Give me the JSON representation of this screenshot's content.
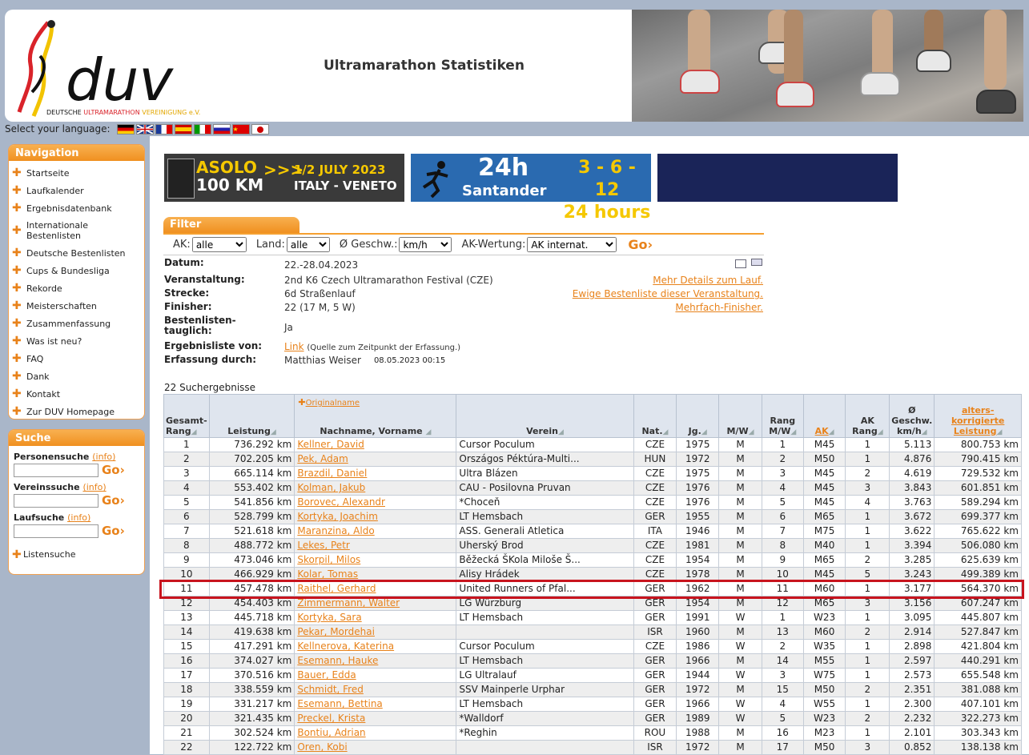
{
  "header": {
    "title": "Ultramarathon Statistiken",
    "logo_text": "duv",
    "logo_sub": [
      "DEUTSCHE",
      "ULTRAMARATHON",
      "VEREINIGUNG e.V."
    ]
  },
  "language": {
    "label": "Select your language:"
  },
  "navigation": {
    "title": "Navigation",
    "items": [
      "Startseite",
      "Laufkalender",
      "Ergebnisdatenbank",
      "Internationale Bestenlisten",
      "Deutsche Bestenlisten",
      "Cups & Bundesliga",
      "Rekorde",
      "Meisterschaften",
      "Zusammenfassung",
      "Was ist neu?",
      "FAQ",
      "Dank",
      "Kontakt",
      "Zur DUV Homepage"
    ]
  },
  "search": {
    "title": "Suche",
    "person": "Personensuche",
    "verein": "Vereinssuche",
    "lauf": "Laufsuche",
    "info": "(info)",
    "go": "Go",
    "list": "Listensuche"
  },
  "banners": {
    "asolo_a": "ASOLO",
    "asolo_b": "100 KM",
    "asolo_c": "1/2 JULY 2023",
    "asolo_d": "ITALY - VENETO",
    "santander_a": "24h",
    "santander_b": "Santander",
    "santander_c": "3 - 6 - 12",
    "santander_d": "24 hours"
  },
  "filter": {
    "title": "Filter",
    "ak_label": "AK:",
    "ak_value": "alle",
    "land_label": "Land:",
    "land_value": "alle",
    "speed_label": "Ø Geschw.:",
    "speed_value": "km/h",
    "akw_label": "AK-Wertung:",
    "akw_value": "AK internat.",
    "go": "Go"
  },
  "event": {
    "datum_label": "Datum:",
    "datum": "22.-28.04.2023",
    "veranst_label": "Veranstaltung:",
    "veranst": "2nd K6 Czech Ultramarathon Festival (CZE)",
    "strecke_label": "Strecke:",
    "strecke": "6d Straßenlauf",
    "finisher_label": "Finisher:",
    "finisher": "22 (17 M, 5 W)",
    "best_label": "Bestenlisten-tauglich:",
    "best": "Ja",
    "ergebnis_label": "Ergebnisliste von:",
    "ergebnis_link": "Link",
    "ergebnis_note": "(Quelle zum Zeitpunkt der Erfassung.)",
    "erfassung_label": "Erfassung durch:",
    "erfassung": "Matthias Weiser",
    "erfassung_time": "08.05.2023 00:15",
    "link_details": "Mehr Details zum Lauf.",
    "link_ewige": "Ewige Bestenliste dieser Veranstaltung.",
    "link_mehrfach": "Mehrfach-Finisher."
  },
  "results": {
    "count": "22 Suchergebnisse",
    "originalname": "Originalname",
    "headers": {
      "rang": "Gesamt-Rang",
      "leistung": "Leistung",
      "name": "Nachname, Vorname",
      "verein": "Verein",
      "nat": "Nat.",
      "jg": "Jg.",
      "mw": "M/W",
      "rangmw": "Rang M/W",
      "ak": "AK",
      "akrang": "AK Rang",
      "speed": "Ø Geschw. km/h",
      "alters": "alters-korrigierte Leistung"
    },
    "rows": [
      [
        "1",
        "736.292 km",
        "Kellner, David",
        "Cursor Poculum",
        "CZE",
        "1975",
        "M",
        "1",
        "M45",
        "1",
        "5.113",
        "800.753 km"
      ],
      [
        "2",
        "702.205 km",
        "Pek, Adam",
        "Országos Péktúra-Multi...",
        "HUN",
        "1972",
        "M",
        "2",
        "M50",
        "1",
        "4.876",
        "790.415 km"
      ],
      [
        "3",
        "665.114 km",
        "Brazdil, Daniel",
        "Ultra Blázen",
        "CZE",
        "1975",
        "M",
        "3",
        "M45",
        "2",
        "4.619",
        "729.532 km"
      ],
      [
        "4",
        "553.402 km",
        "Kolman, Jakub",
        "CAU - Posilovna Pruvan",
        "CZE",
        "1976",
        "M",
        "4",
        "M45",
        "3",
        "3.843",
        "601.851 km"
      ],
      [
        "5",
        "541.856 km",
        "Borovec, Alexandr",
        "*Choceň",
        "CZE",
        "1976",
        "M",
        "5",
        "M45",
        "4",
        "3.763",
        "589.294 km"
      ],
      [
        "6",
        "528.799 km",
        "Kortyka, Joachim",
        "LT Hemsbach",
        "GER",
        "1955",
        "M",
        "6",
        "M65",
        "1",
        "3.672",
        "699.377 km"
      ],
      [
        "7",
        "521.618 km",
        "Maranzina, Aldo",
        "ASS. Generali Atletica",
        "ITA",
        "1946",
        "M",
        "7",
        "M75",
        "1",
        "3.622",
        "765.622 km"
      ],
      [
        "8",
        "488.772 km",
        "Lekes, Petr",
        "Uherský Brod",
        "CZE",
        "1981",
        "M",
        "8",
        "M40",
        "1",
        "3.394",
        "506.080 km"
      ],
      [
        "9",
        "473.046 km",
        "Skorpil, Milos",
        "Běžecká ŠKola Miloše Š...",
        "CZE",
        "1954",
        "M",
        "9",
        "M65",
        "2",
        "3.285",
        "625.639 km"
      ],
      [
        "10",
        "466.929 km",
        "Kolar, Tomas",
        "Alisy Hrádek",
        "CZE",
        "1978",
        "M",
        "10",
        "M45",
        "5",
        "3.243",
        "499.389 km"
      ],
      [
        "11",
        "457.478 km",
        "Raithel, Gerhard",
        "United Runners of Pfal...",
        "GER",
        "1962",
        "M",
        "11",
        "M60",
        "1",
        "3.177",
        "564.370 km"
      ],
      [
        "12",
        "454.403 km",
        "Zimmermann, Walter",
        "LG Würzburg",
        "GER",
        "1954",
        "M",
        "12",
        "M65",
        "3",
        "3.156",
        "607.247 km"
      ],
      [
        "13",
        "445.718 km",
        "Kortyka, Sara",
        "LT Hemsbach",
        "GER",
        "1991",
        "W",
        "1",
        "W23",
        "1",
        "3.095",
        "445.807 km"
      ],
      [
        "14",
        "419.638 km",
        "Pekar, Mordehai",
        "",
        "ISR",
        "1960",
        "M",
        "13",
        "M60",
        "2",
        "2.914",
        "527.847 km"
      ],
      [
        "15",
        "417.291 km",
        "Kellnerova, Katerina",
        "Cursor Poculum",
        "CZE",
        "1986",
        "W",
        "2",
        "W35",
        "1",
        "2.898",
        "421.804 km"
      ],
      [
        "16",
        "374.027 km",
        "Esemann, Hauke",
        "LT Hemsbach",
        "GER",
        "1966",
        "M",
        "14",
        "M55",
        "1",
        "2.597",
        "440.291 km"
      ],
      [
        "17",
        "370.516 km",
        "Bauer, Edda",
        "LG Ultralauf",
        "GER",
        "1944",
        "W",
        "3",
        "W75",
        "1",
        "2.573",
        "655.548 km"
      ],
      [
        "18",
        "338.559 km",
        "Schmidt, Fred",
        "SSV Mainperle Urphar",
        "GER",
        "1972",
        "M",
        "15",
        "M50",
        "2",
        "2.351",
        "381.088 km"
      ],
      [
        "19",
        "331.217 km",
        "Esemann, Bettina",
        "LT Hemsbach",
        "GER",
        "1966",
        "W",
        "4",
        "W55",
        "1",
        "2.300",
        "407.101 km"
      ],
      [
        "20",
        "321.435 km",
        "Preckel, Krista",
        "*Walldorf",
        "GER",
        "1989",
        "W",
        "5",
        "W23",
        "2",
        "2.232",
        "322.273 km"
      ],
      [
        "21",
        "302.524 km",
        "Bontiu, Adrian",
        "*Reghin",
        "ROU",
        "1988",
        "M",
        "16",
        "M23",
        "1",
        "2.101",
        "303.343 km"
      ],
      [
        "22",
        "122.722 km",
        "Oren, Kobi",
        "",
        "ISR",
        "1972",
        "M",
        "17",
        "M50",
        "3",
        "0.852",
        "138.138 km"
      ]
    ]
  }
}
